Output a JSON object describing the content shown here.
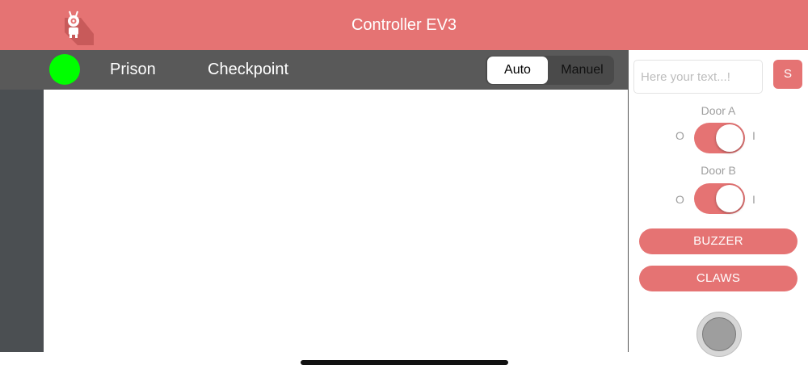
{
  "app": {
    "title": "Controller EV3",
    "accent_color": "#e57373",
    "logo_icon": "robot-icon"
  },
  "topbar": {
    "status_color": "#00ff00",
    "nav": [
      {
        "label": "Prison"
      },
      {
        "label": "Checkpoint"
      }
    ],
    "mode": {
      "options": [
        "Auto",
        "Manuel"
      ],
      "selected": "Auto"
    }
  },
  "panel": {
    "text_input": {
      "placeholder": "Here your text...!",
      "value": ""
    },
    "send_label": "S",
    "doors": [
      {
        "label": "Door A",
        "off_label": "O",
        "on_label": "I",
        "on": true
      },
      {
        "label": "Door B",
        "off_label": "O",
        "on_label": "I",
        "on": true
      }
    ],
    "buttons": {
      "buzzer": "BUZZER",
      "claws": "CLAWS"
    },
    "joystick_icon": "joystick-icon"
  }
}
